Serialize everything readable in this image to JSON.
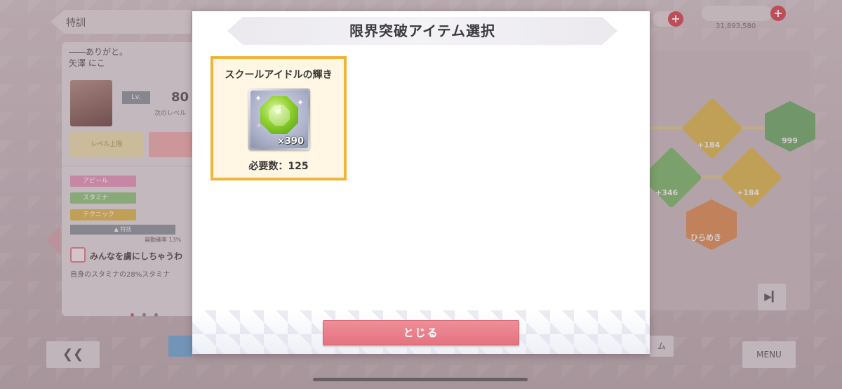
{
  "background": {
    "header_tab": "特訓",
    "status": {
      "coin_amount": "31,893,580"
    },
    "card": {
      "quote": "――ありがと。",
      "idol_name": "矢澤 にこ",
      "level_badge": "Lv.",
      "level_value": "80",
      "level_next_label": "次のレベル",
      "button_level_up": "レベル上限",
      "stat_appeal": "アピール",
      "stat_stamina": "スタミナ",
      "stat_technique": "テクニック",
      "skill_bar": "▲ 特技",
      "skill_rate": "発動確率 13%",
      "skill_title": "みんなを虜にしちゃうわ",
      "skill_desc": "自身のスタミナの28%スタミナ"
    },
    "nodes": {
      "node_1": "+184",
      "node_2": "+346",
      "node_3": "+184",
      "node_4": "ひらめき",
      "node_5": "999"
    },
    "back_button": "❮❮",
    "menu_button": "MENU",
    "item_button_partial": "ム",
    "skip_icon": "▶▎"
  },
  "modal": {
    "title": "限界突破アイテム選択",
    "items": [
      {
        "name": "スクールアイドルの輝き",
        "icon": "green-gem-feather-icon",
        "count": "×390",
        "required": "必要数：125",
        "highlight_color": "#f1b43a"
      }
    ],
    "close_label": "とじる",
    "close_color": "#e47380"
  }
}
